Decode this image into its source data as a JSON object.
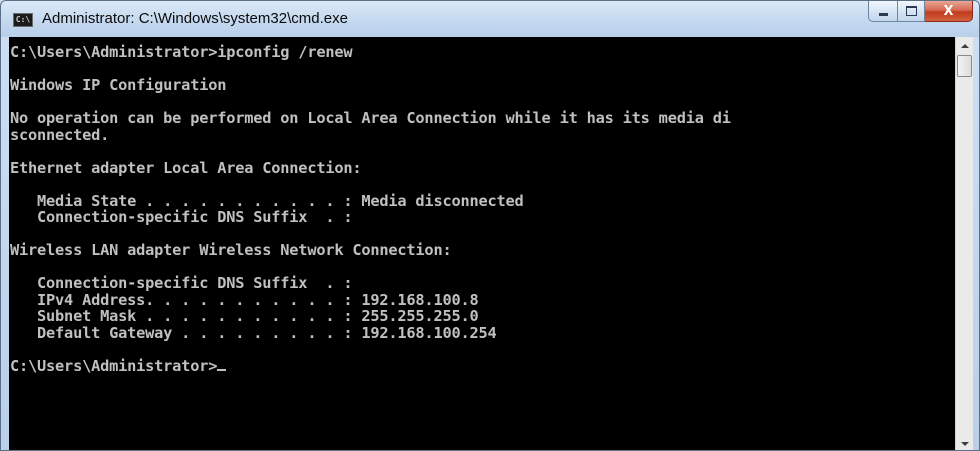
{
  "window": {
    "title": "Administrator: C:\\Windows\\system32\\cmd.exe",
    "icon": "cmd-icon",
    "icon_text": "C:\\",
    "controls": {
      "minimize": "minimize-icon",
      "maximize": "maximize-icon",
      "close": "close-icon",
      "close_glyph": "X"
    }
  },
  "console": {
    "lines": [
      "C:\\Users\\Administrator>ipconfig /renew",
      "",
      "Windows IP Configuration",
      "",
      "No operation can be performed on Local Area Connection while it has its media di",
      "sconnected.",
      "",
      "Ethernet adapter Local Area Connection:",
      "",
      "   Media State . . . . . . . . . . . : Media disconnected",
      "   Connection-specific DNS Suffix  . :",
      "",
      "Wireless LAN adapter Wireless Network Connection:",
      "",
      "   Connection-specific DNS Suffix  . :",
      "   IPv4 Address. . . . . . . . . . . : 192.168.100.8",
      "   Subnet Mask . . . . . . . . . . . : 255.255.255.0",
      "   Default Gateway . . . . . . . . . : 192.168.100.254",
      ""
    ],
    "prompt": "C:\\Users\\Administrator>",
    "text_color": "#c0c0c0",
    "background": "#000000"
  },
  "scrollbar": {
    "up": "scroll-up-arrow-icon",
    "down": "scroll-down-arrow-icon"
  }
}
